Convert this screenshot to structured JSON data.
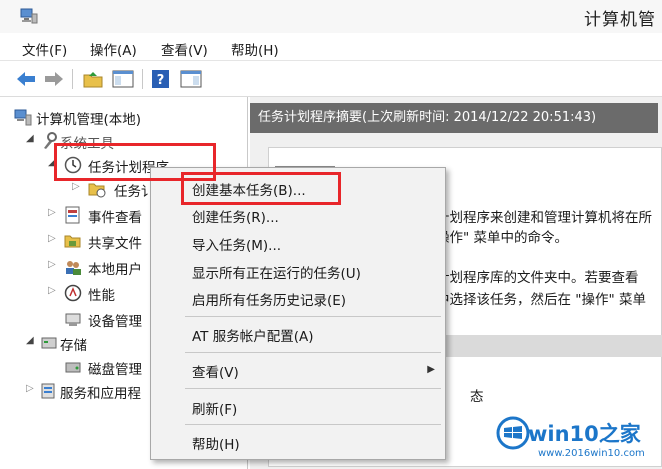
{
  "window": {
    "title": "计算机管"
  },
  "menu": {
    "file": "文件(F)",
    "action": "操作(A)",
    "view": "查看(V)",
    "help": "帮助(H)"
  },
  "toolbar": {
    "back": "back-arrow-icon",
    "forward": "forward-arrow-icon",
    "up": "folder-up-icon",
    "show_hide": "console-tree-icon",
    "help": "help-icon",
    "action_pane": "action-pane-icon"
  },
  "tree": {
    "root": "计算机管理(本地)",
    "system_tools": "系统工具",
    "task_scheduler": "任务计划程序",
    "task_library": "任务讠",
    "event_viewer": "事件查看",
    "shared_folders": "共享文件",
    "local_users": "本地用户",
    "performance": "性能",
    "device_manager": "设备管理",
    "storage": "存储",
    "disk_management": "磁盘管理",
    "services_apps": "服务和应用程"
  },
  "summary": {
    "header": "任务计划程序摘要(上次刷新时间: 2014/12/22 20:51:43)",
    "lines": [
      "十划程序来创建和管理计算机将在所",
      "操作\" 菜单中的命令。",
      "计划程序库的文件夹中。若要查看",
      "中选择该任务，然后在 \"操作\" 菜单",
      "态"
    ]
  },
  "context_menu": {
    "items": [
      "创建基本任务(B)...",
      "创建任务(R)...",
      "导入任务(M)...",
      "显示所有正在运行的任务(U)",
      "启用所有任务历史记录(E)",
      "AT 服务帐户配置(A)",
      "查看(V)",
      "刷新(F)",
      "帮助(H)"
    ]
  },
  "watermark": {
    "brand": "win10之家",
    "url": "www.2016win10.com"
  },
  "colors": {
    "highlight": "#e8262a",
    "brand": "#1c76c9",
    "header": "#6b6b6b"
  }
}
